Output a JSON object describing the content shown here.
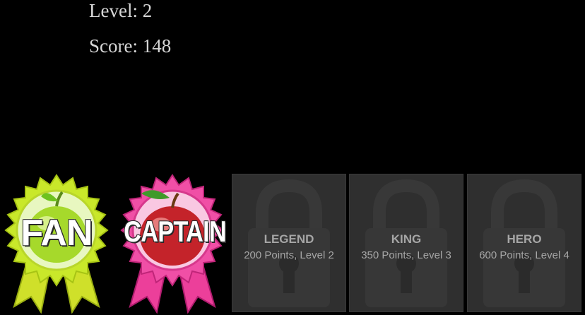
{
  "stats": {
    "level": "Level: 2",
    "score": "Score: 148"
  },
  "badges": [
    {
      "label": "FAN",
      "icon": "apple-ribbon-icon",
      "color": "#b6e21f",
      "ribbon_color": "#d7ea22"
    },
    {
      "label": "CAPTAIN",
      "icon": "apple-ribbon-icon",
      "color": "#e23c97",
      "ribbon_color": "#ec3f9a"
    }
  ],
  "locked_badges": [
    {
      "name": "LEGEND",
      "requirement": "200 Points, Level 2",
      "icon": "padlock-icon"
    },
    {
      "name": "KING",
      "requirement": "350 Points, Level 3",
      "icon": "padlock-icon"
    },
    {
      "name": "HERO",
      "requirement": "600 Points, Level 4",
      "icon": "padlock-icon"
    }
  ]
}
